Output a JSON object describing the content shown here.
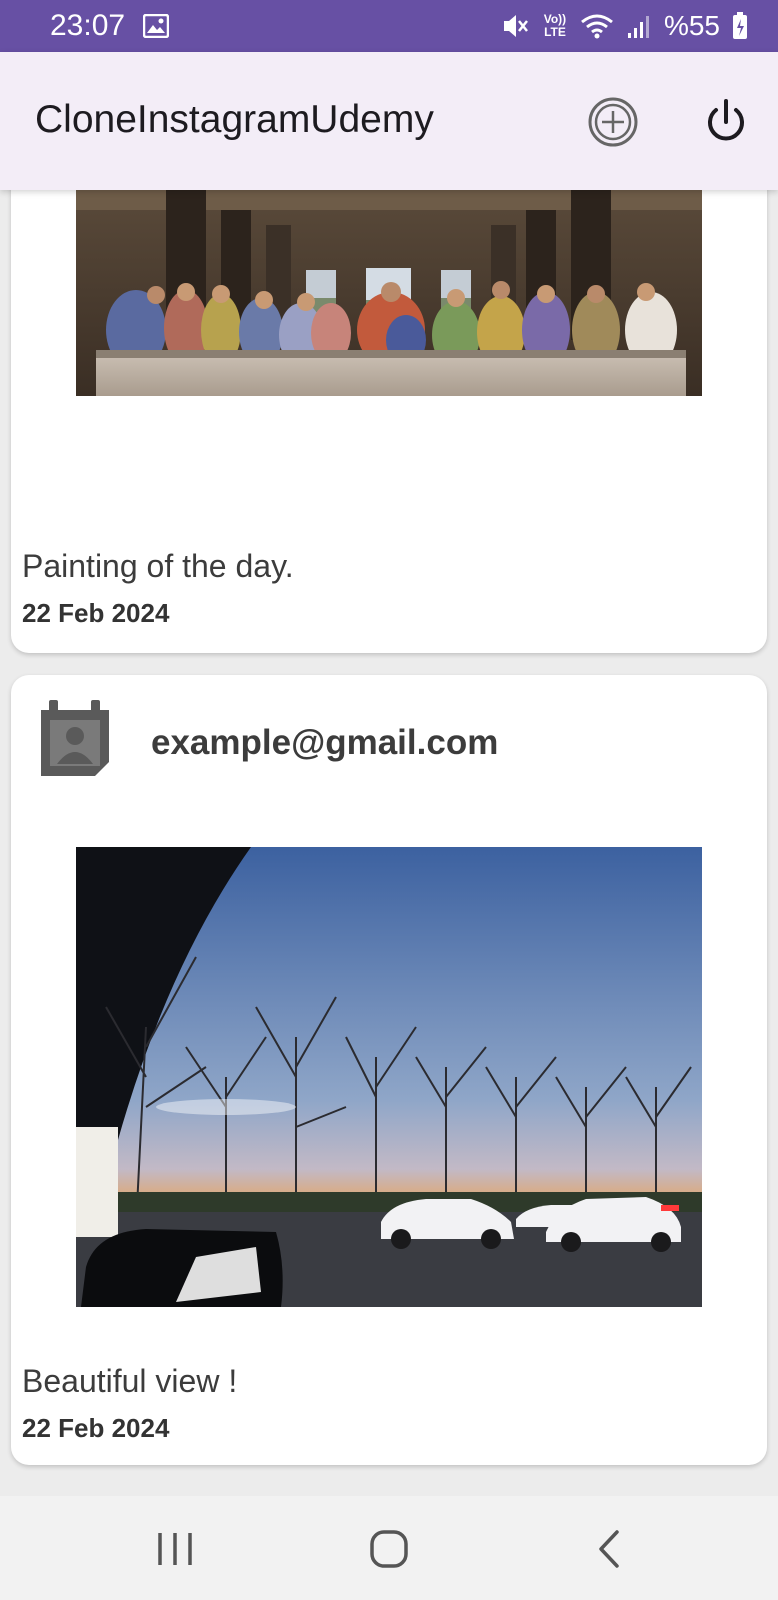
{
  "status_bar": {
    "time": "23:07",
    "battery": "%55",
    "icons": [
      "gallery-icon",
      "mute-icon",
      "volte-icon",
      "wifi-icon",
      "signal-icon",
      "battery-icon"
    ],
    "volte_text": "Vo)) LTE",
    "background": "#6750a4"
  },
  "app_bar": {
    "title": "CloneInstagramUdemy",
    "actions": [
      "add-post-icon",
      "power-icon"
    ],
    "background": "#f3edf7"
  },
  "posts": [
    {
      "caption": "Painting of the day.",
      "date": "22 Feb 2024",
      "image": "last-supper-painting"
    },
    {
      "user": "example@gmail.com",
      "avatar": "account-box-icon",
      "caption": "Beautiful view !",
      "date": "22 Feb 2024",
      "image": "sunset-parking-lot-photo"
    }
  ],
  "nav_bar": {
    "buttons": [
      "recent-apps-icon",
      "home-icon",
      "back-icon"
    ]
  }
}
